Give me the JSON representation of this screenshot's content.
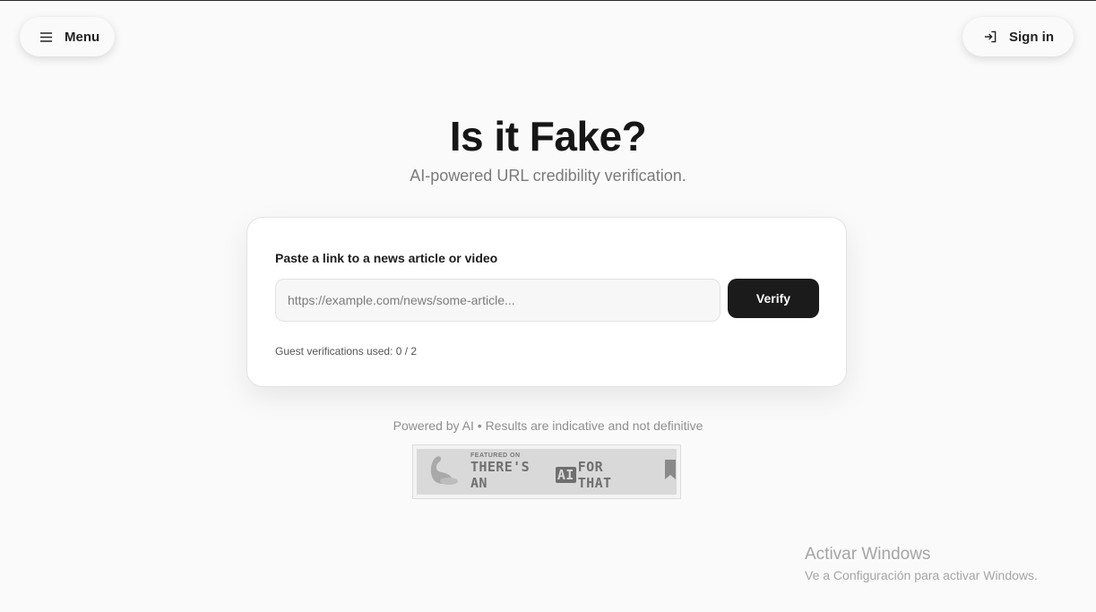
{
  "header": {
    "menu_label": "Menu",
    "menu_icon": "hamburger-icon",
    "signin_label": "Sign in",
    "signin_icon": "login-arrow-icon"
  },
  "hero": {
    "title": "Is it Fake?",
    "subtitle": "AI-powered URL credibility verification."
  },
  "verify_card": {
    "label": "Paste a link to a news article or video",
    "input_placeholder": "https://example.com/news/some-article...",
    "input_value": "",
    "verify_label": "Verify",
    "usage_text": "Guest verifications used: 0 / 2"
  },
  "footer": {
    "note": "Powered by AI • Results are indicative and not definitive",
    "badge": {
      "small_text": "FEATURED ON",
      "text_before": "THERE'S AN",
      "text_ai": "AI",
      "text_after": "FOR THAT"
    }
  },
  "windows_watermark": {
    "title": "Activar Windows",
    "subtitle": "Ve a Configuración para activar Windows."
  },
  "colors": {
    "background": "#fafafa",
    "primary_button": "#1b1b1b",
    "muted_text": "#8f8f8f"
  }
}
